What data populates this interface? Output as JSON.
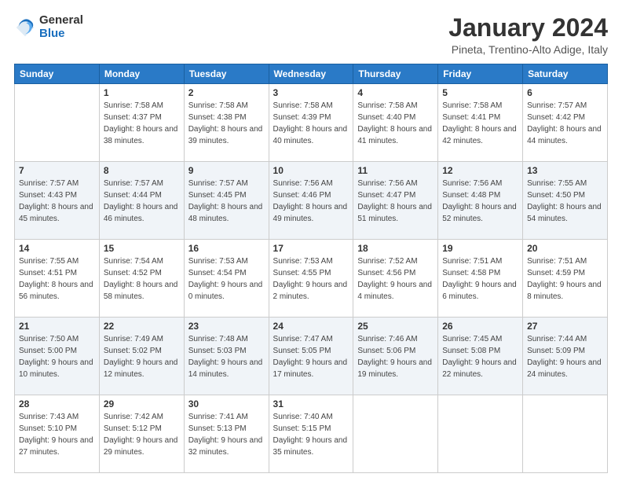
{
  "logo": {
    "general": "General",
    "blue": "Blue"
  },
  "title": {
    "month_year": "January 2024",
    "location": "Pineta, Trentino-Alto Adige, Italy"
  },
  "headers": [
    "Sunday",
    "Monday",
    "Tuesday",
    "Wednesday",
    "Thursday",
    "Friday",
    "Saturday"
  ],
  "weeks": [
    [
      {
        "day": "",
        "sunrise": "",
        "sunset": "",
        "daylight": ""
      },
      {
        "day": "1",
        "sunrise": "Sunrise: 7:58 AM",
        "sunset": "Sunset: 4:37 PM",
        "daylight": "Daylight: 8 hours and 38 minutes."
      },
      {
        "day": "2",
        "sunrise": "Sunrise: 7:58 AM",
        "sunset": "Sunset: 4:38 PM",
        "daylight": "Daylight: 8 hours and 39 minutes."
      },
      {
        "day": "3",
        "sunrise": "Sunrise: 7:58 AM",
        "sunset": "Sunset: 4:39 PM",
        "daylight": "Daylight: 8 hours and 40 minutes."
      },
      {
        "day": "4",
        "sunrise": "Sunrise: 7:58 AM",
        "sunset": "Sunset: 4:40 PM",
        "daylight": "Daylight: 8 hours and 41 minutes."
      },
      {
        "day": "5",
        "sunrise": "Sunrise: 7:58 AM",
        "sunset": "Sunset: 4:41 PM",
        "daylight": "Daylight: 8 hours and 42 minutes."
      },
      {
        "day": "6",
        "sunrise": "Sunrise: 7:57 AM",
        "sunset": "Sunset: 4:42 PM",
        "daylight": "Daylight: 8 hours and 44 minutes."
      }
    ],
    [
      {
        "day": "7",
        "sunrise": "Sunrise: 7:57 AM",
        "sunset": "Sunset: 4:43 PM",
        "daylight": "Daylight: 8 hours and 45 minutes."
      },
      {
        "day": "8",
        "sunrise": "Sunrise: 7:57 AM",
        "sunset": "Sunset: 4:44 PM",
        "daylight": "Daylight: 8 hours and 46 minutes."
      },
      {
        "day": "9",
        "sunrise": "Sunrise: 7:57 AM",
        "sunset": "Sunset: 4:45 PM",
        "daylight": "Daylight: 8 hours and 48 minutes."
      },
      {
        "day": "10",
        "sunrise": "Sunrise: 7:56 AM",
        "sunset": "Sunset: 4:46 PM",
        "daylight": "Daylight: 8 hours and 49 minutes."
      },
      {
        "day": "11",
        "sunrise": "Sunrise: 7:56 AM",
        "sunset": "Sunset: 4:47 PM",
        "daylight": "Daylight: 8 hours and 51 minutes."
      },
      {
        "day": "12",
        "sunrise": "Sunrise: 7:56 AM",
        "sunset": "Sunset: 4:48 PM",
        "daylight": "Daylight: 8 hours and 52 minutes."
      },
      {
        "day": "13",
        "sunrise": "Sunrise: 7:55 AM",
        "sunset": "Sunset: 4:50 PM",
        "daylight": "Daylight: 8 hours and 54 minutes."
      }
    ],
    [
      {
        "day": "14",
        "sunrise": "Sunrise: 7:55 AM",
        "sunset": "Sunset: 4:51 PM",
        "daylight": "Daylight: 8 hours and 56 minutes."
      },
      {
        "day": "15",
        "sunrise": "Sunrise: 7:54 AM",
        "sunset": "Sunset: 4:52 PM",
        "daylight": "Daylight: 8 hours and 58 minutes."
      },
      {
        "day": "16",
        "sunrise": "Sunrise: 7:53 AM",
        "sunset": "Sunset: 4:54 PM",
        "daylight": "Daylight: 9 hours and 0 minutes."
      },
      {
        "day": "17",
        "sunrise": "Sunrise: 7:53 AM",
        "sunset": "Sunset: 4:55 PM",
        "daylight": "Daylight: 9 hours and 2 minutes."
      },
      {
        "day": "18",
        "sunrise": "Sunrise: 7:52 AM",
        "sunset": "Sunset: 4:56 PM",
        "daylight": "Daylight: 9 hours and 4 minutes."
      },
      {
        "day": "19",
        "sunrise": "Sunrise: 7:51 AM",
        "sunset": "Sunset: 4:58 PM",
        "daylight": "Daylight: 9 hours and 6 minutes."
      },
      {
        "day": "20",
        "sunrise": "Sunrise: 7:51 AM",
        "sunset": "Sunset: 4:59 PM",
        "daylight": "Daylight: 9 hours and 8 minutes."
      }
    ],
    [
      {
        "day": "21",
        "sunrise": "Sunrise: 7:50 AM",
        "sunset": "Sunset: 5:00 PM",
        "daylight": "Daylight: 9 hours and 10 minutes."
      },
      {
        "day": "22",
        "sunrise": "Sunrise: 7:49 AM",
        "sunset": "Sunset: 5:02 PM",
        "daylight": "Daylight: 9 hours and 12 minutes."
      },
      {
        "day": "23",
        "sunrise": "Sunrise: 7:48 AM",
        "sunset": "Sunset: 5:03 PM",
        "daylight": "Daylight: 9 hours and 14 minutes."
      },
      {
        "day": "24",
        "sunrise": "Sunrise: 7:47 AM",
        "sunset": "Sunset: 5:05 PM",
        "daylight": "Daylight: 9 hours and 17 minutes."
      },
      {
        "day": "25",
        "sunrise": "Sunrise: 7:46 AM",
        "sunset": "Sunset: 5:06 PM",
        "daylight": "Daylight: 9 hours and 19 minutes."
      },
      {
        "day": "26",
        "sunrise": "Sunrise: 7:45 AM",
        "sunset": "Sunset: 5:08 PM",
        "daylight": "Daylight: 9 hours and 22 minutes."
      },
      {
        "day": "27",
        "sunrise": "Sunrise: 7:44 AM",
        "sunset": "Sunset: 5:09 PM",
        "daylight": "Daylight: 9 hours and 24 minutes."
      }
    ],
    [
      {
        "day": "28",
        "sunrise": "Sunrise: 7:43 AM",
        "sunset": "Sunset: 5:10 PM",
        "daylight": "Daylight: 9 hours and 27 minutes."
      },
      {
        "day": "29",
        "sunrise": "Sunrise: 7:42 AM",
        "sunset": "Sunset: 5:12 PM",
        "daylight": "Daylight: 9 hours and 29 minutes."
      },
      {
        "day": "30",
        "sunrise": "Sunrise: 7:41 AM",
        "sunset": "Sunset: 5:13 PM",
        "daylight": "Daylight: 9 hours and 32 minutes."
      },
      {
        "day": "31",
        "sunrise": "Sunrise: 7:40 AM",
        "sunset": "Sunset: 5:15 PM",
        "daylight": "Daylight: 9 hours and 35 minutes."
      },
      {
        "day": "",
        "sunrise": "",
        "sunset": "",
        "daylight": ""
      },
      {
        "day": "",
        "sunrise": "",
        "sunset": "",
        "daylight": ""
      },
      {
        "day": "",
        "sunrise": "",
        "sunset": "",
        "daylight": ""
      }
    ]
  ]
}
